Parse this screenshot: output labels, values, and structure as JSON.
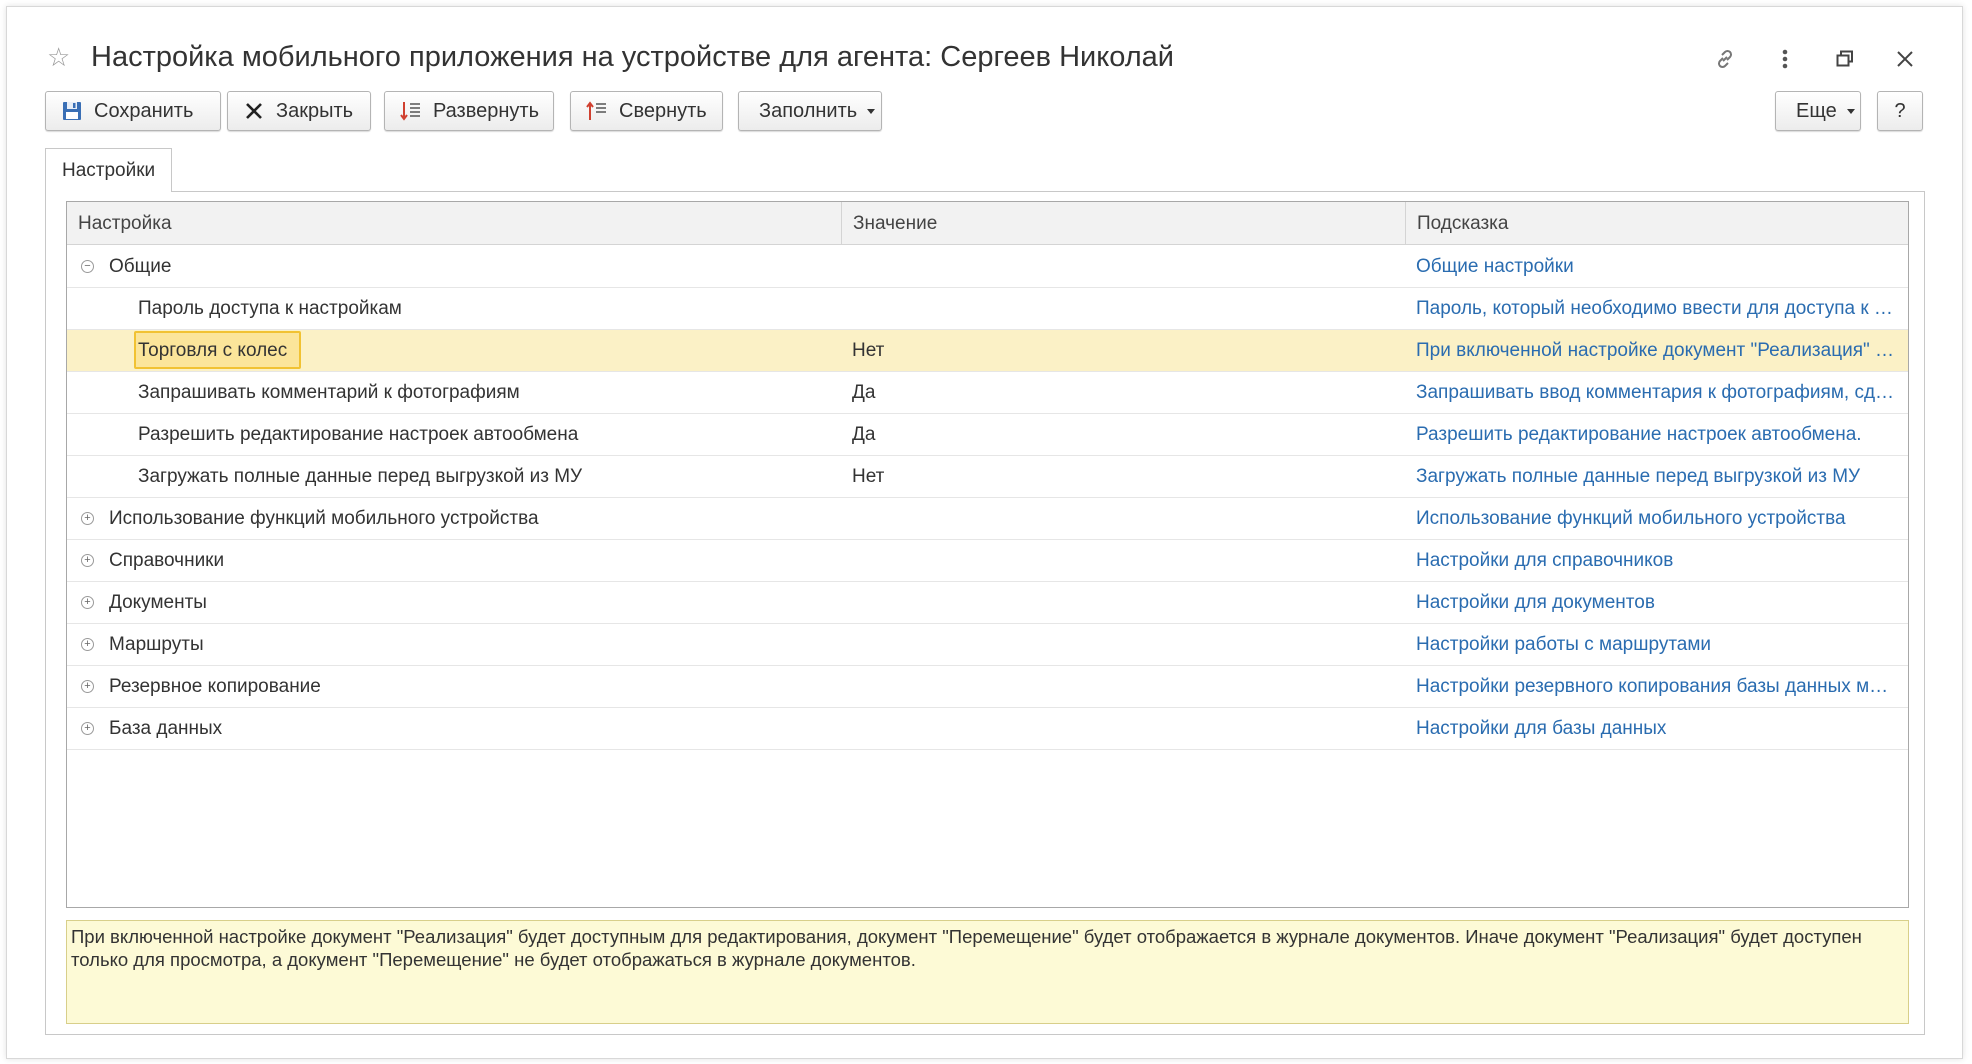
{
  "window": {
    "title": "Настройка мобильного приложения на устройстве для агента: Сергеев Николай"
  },
  "toolbar": {
    "save_label": "Сохранить",
    "close_label": "Закрыть",
    "expand_label": "Развернуть",
    "collapse_label": "Свернуть",
    "fill_label": "Заполнить",
    "more_label": "Еще",
    "help_label": "?"
  },
  "tabs": [
    {
      "label": "Настройки",
      "active": true
    }
  ],
  "table": {
    "columns": [
      "Настройка",
      "Значение",
      "Подсказка"
    ],
    "rows": [
      {
        "level": 0,
        "expander": "⊖",
        "name": "Общие",
        "value": "",
        "hint": "Общие настройки"
      },
      {
        "level": 1,
        "expander": "",
        "name": "Пароль доступа к настройкам",
        "value": "",
        "hint": "Пароль, который необходимо ввести для доступа к настройкам"
      },
      {
        "level": 1,
        "expander": "",
        "name": "Торговля с колес",
        "value": "Нет",
        "hint": "При включенной настройке документ \"Реализация\" будет доступным для редактирования",
        "selected": true
      },
      {
        "level": 1,
        "expander": "",
        "name": "Запрашивать комментарий к фотографиям",
        "value": "Да",
        "hint": "Запрашивать ввод комментария к фотографиям, сделанным на устройстве"
      },
      {
        "level": 1,
        "expander": "",
        "name": "Разрешить редактирование настроек автообмена",
        "value": "Да",
        "hint": "Разрешить редактирование настроек автообмена."
      },
      {
        "level": 1,
        "expander": "",
        "name": "Загружать полные данные перед выгрузкой из МУ",
        "value": "Нет",
        "hint": "Загружать полные данные перед выгрузкой из МУ"
      },
      {
        "level": 0,
        "expander": "⊕",
        "name": "Использование функций мобильного устройства",
        "value": "",
        "hint": "Использование функций мобильного устройства"
      },
      {
        "level": 0,
        "expander": "⊕",
        "name": "Справочники",
        "value": "",
        "hint": "Настройки для справочников"
      },
      {
        "level": 0,
        "expander": "⊕",
        "name": "Документы",
        "value": "",
        "hint": "Настройки для документов"
      },
      {
        "level": 0,
        "expander": "⊕",
        "name": "Маршруты",
        "value": "",
        "hint": "Настройки работы с маршрутами"
      },
      {
        "level": 0,
        "expander": "⊕",
        "name": "Резервное копирование",
        "value": "",
        "hint": "Настройки резервного копирования базы данных мобильного устройства"
      },
      {
        "level": 0,
        "expander": "⊕",
        "name": "База данных",
        "value": "",
        "hint": "Настройки для базы данных"
      }
    ]
  },
  "hint_panel": {
    "text": "При включенной настройке документ \"Реализация\" будет доступным для редактирования, документ \"Перемещение\" будет отображается в журнале документов. Иначе документ \"Реализация\" будет доступен только для просмотра, а документ \"Перемещение\" не будет отображаться в журнале документов."
  },
  "colors": {
    "link": "#2a6cb0",
    "selected_row": "#fbf1c6",
    "focus_border": "#f1c232",
    "hint_bg": "#fdfad6"
  },
  "icons": {
    "star": "star-icon",
    "link": "link-icon",
    "more": "kebab-icon",
    "maximize": "maximize-icon",
    "close": "close-icon"
  }
}
